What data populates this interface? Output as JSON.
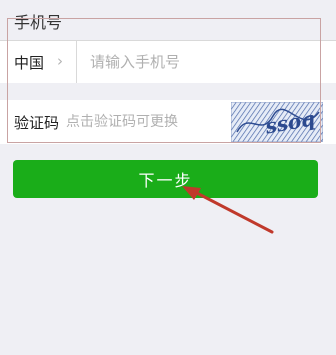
{
  "section_title": "手机号",
  "phone": {
    "country": "中国",
    "chevron": "›",
    "placeholder": "请输入手机号",
    "value": ""
  },
  "verification": {
    "label": "验证码",
    "placeholder": "点击验证码可更换",
    "value": "",
    "captcha_text": "ssoq"
  },
  "next_button": "下一步",
  "colors": {
    "accent": "#1aad19",
    "annotation": "#c0392b"
  }
}
